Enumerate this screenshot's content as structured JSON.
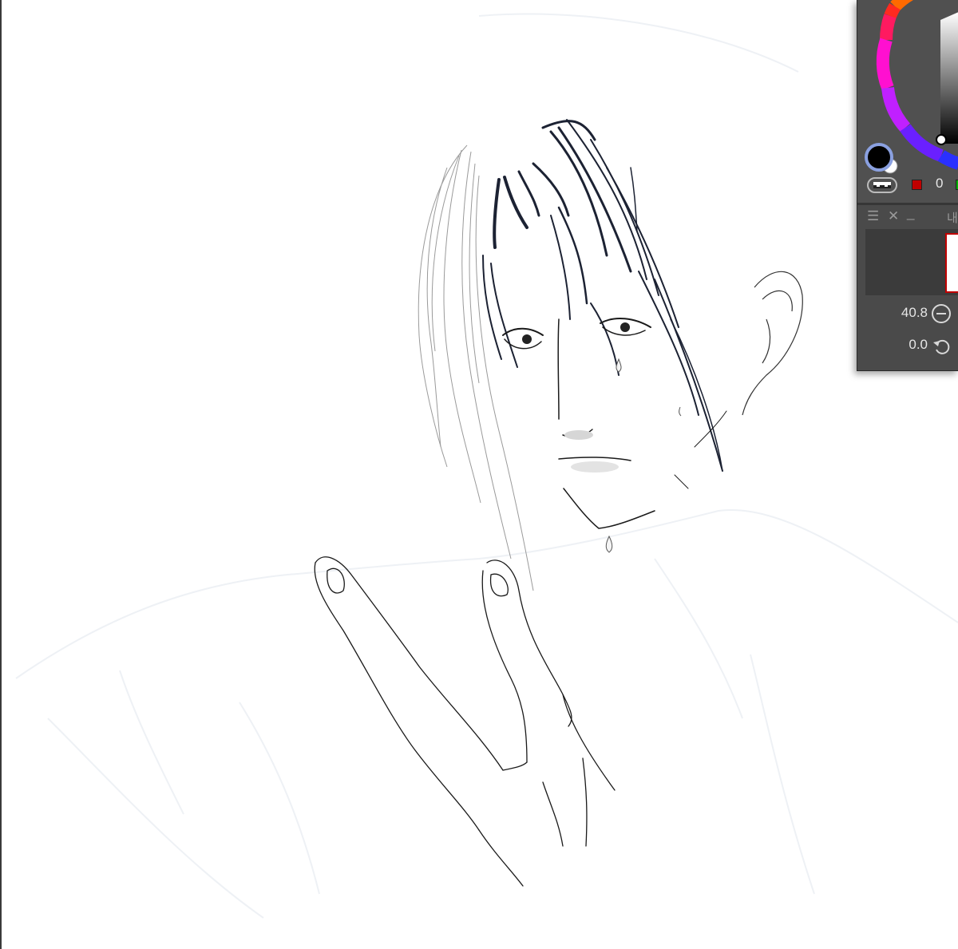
{
  "app": {
    "accent_color": "#c00000",
    "panel_color": "#4a4a4a"
  },
  "color_panel": {
    "main_color": "#000000",
    "sub_color": "#ffffff",
    "red_value": "0",
    "icons": [
      "color-wheel-icon",
      "main-color-swatch-icon",
      "color-mode-toggle-icon"
    ]
  },
  "navigator_panel": {
    "title": "내",
    "menu_icon": "menu-icon",
    "close_icon": "close-icon",
    "minimize_icon": "minimize-icon",
    "zoom_value": "40.8",
    "rotation_value": "0.0",
    "zoom_out_icon": "zoom-out-icon",
    "reset_rotation_icon": "reset-rotation-icon"
  }
}
